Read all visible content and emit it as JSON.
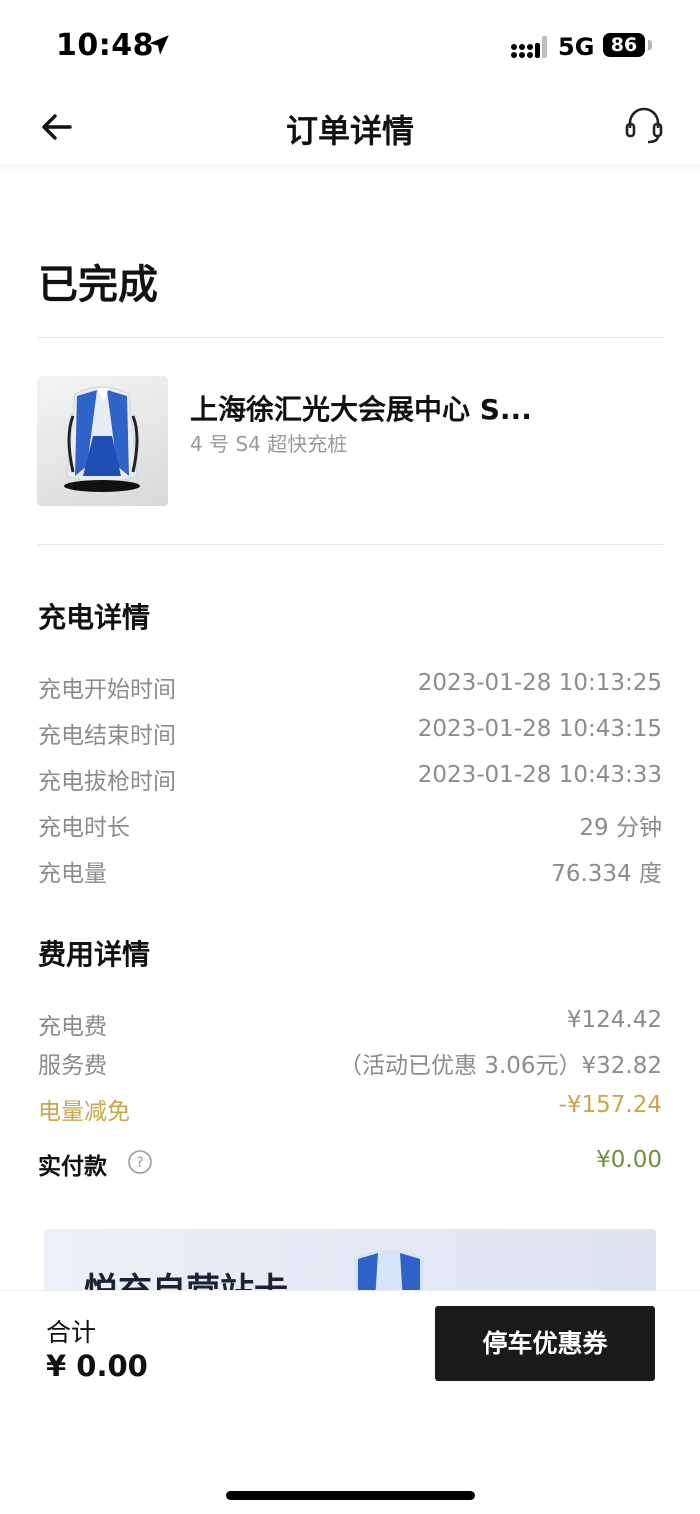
{
  "status_bar": {
    "time": "10:48",
    "network": "5G",
    "battery": "86",
    "icons": [
      "location-arrow-icon",
      "signal-icon"
    ]
  },
  "nav": {
    "title": "订单详情",
    "back_icon": "arrow-left-icon",
    "support_icon": "headset-icon"
  },
  "order": {
    "status": "已完成"
  },
  "station": {
    "name": "上海徐汇光大会展中心 S...",
    "subtitle": "4 号 S4 超快充桩",
    "image_icon": "charging-pile-image"
  },
  "charging": {
    "title": "充电详情",
    "rows": [
      {
        "label": "充电开始时间",
        "value": "2023-01-28 10:13:25"
      },
      {
        "label": "充电结束时间",
        "value": "2023-01-28 10:43:15"
      },
      {
        "label": "充电拔枪时间",
        "value": "2023-01-28 10:43:33"
      },
      {
        "label": "充电时长",
        "value": "29 分钟"
      },
      {
        "label": "充电量",
        "value": "76.334 度"
      }
    ]
  },
  "fees": {
    "title": "费用详情",
    "charge_fee": {
      "label": "充电费",
      "value": "¥124.42"
    },
    "service_fee": {
      "label": "服务费",
      "value": "（活动已优惠 3.06元）¥32.82"
    },
    "discount": {
      "label": "电量减免",
      "value": "-¥157.24"
    },
    "paid": {
      "label": "实付款",
      "value": "¥0.00",
      "help_icon": "question-circle-icon"
    },
    "accent_gold": "#c9a64c",
    "accent_green": "#6e8f3e"
  },
  "banner": {
    "text": "悦充自营站卡"
  },
  "bottom": {
    "total_label": "合计",
    "total_amount": "¥ 0.00",
    "coupon_button": "停车优惠券"
  }
}
